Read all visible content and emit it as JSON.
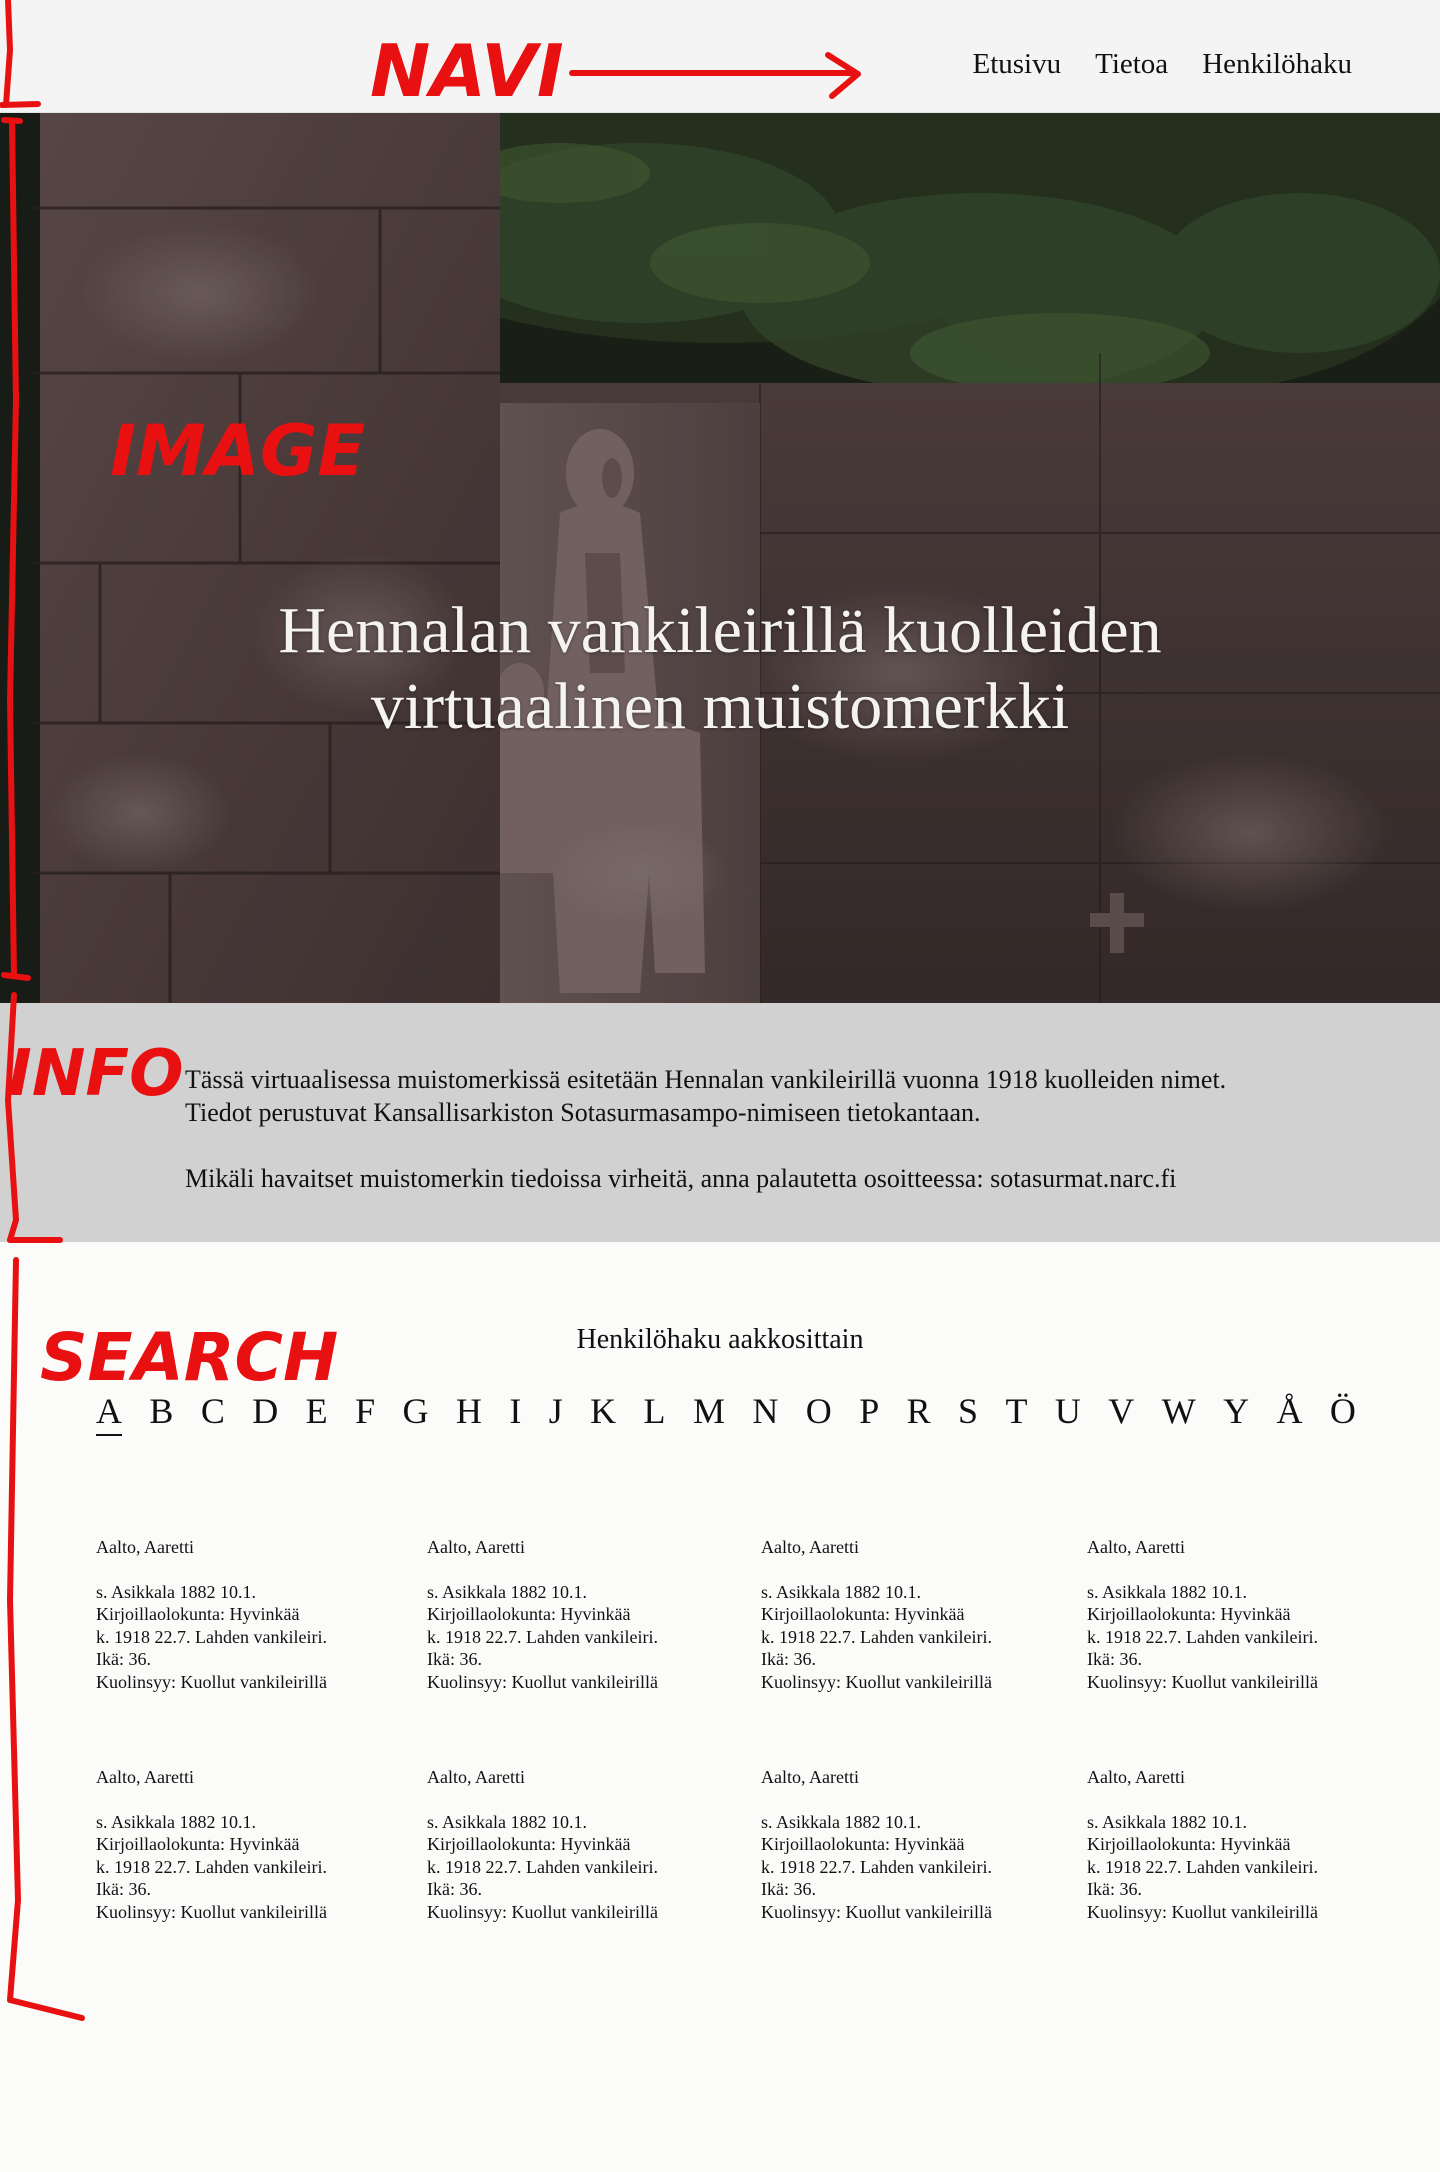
{
  "annotations": {
    "navi": "NAVI",
    "image": "IMAGE",
    "info": "INFO",
    "search": "SEARCH"
  },
  "nav": {
    "links": [
      "Etusivu",
      "Tietoa",
      "Henkilöhaku"
    ]
  },
  "hero": {
    "title_line1": "Hennalan vankileirillä kuolleiden",
    "title_line2": "virtuaalinen muistomerkki"
  },
  "info": {
    "paragraph1": "Tässä virtuaalisessa muistomerkissä esitetään Hennalan vankileirillä vuonna 1918 kuolleiden nimet. Tiedot perustuvat Kansallisarkiston Sotasurmasampo-nimiseen tietokantaan.",
    "paragraph2": "Mikäli havaitset muistomerkin tiedoissa virheitä, anna palautetta osoitteessa: sotasurmat.narc.fi"
  },
  "search": {
    "heading": "Henkilöhaku aakkosittain",
    "letters": [
      "A",
      "B",
      "C",
      "D",
      "E",
      "F",
      "G",
      "H",
      "I",
      "J",
      "K",
      "L",
      "M",
      "N",
      "O",
      "P",
      "R",
      "S",
      "T",
      "U",
      "V",
      "W",
      "Y",
      "Å",
      "Ö"
    ],
    "active_letter": "A"
  },
  "results": [
    {
      "name": "Aalto, Aaretti",
      "born": "s. Asikkala 1882 10.1.",
      "municipality": "Kirjoillaolokunta: Hyvinkää",
      "died": "k. 1918 22.7. Lahden vankileiri.",
      "age": "Ikä: 36.",
      "cause": "Kuolinsyy: Kuollut vankileirillä"
    },
    {
      "name": "Aalto, Aaretti",
      "born": "s. Asikkala 1882 10.1.",
      "municipality": "Kirjoillaolokunta: Hyvinkää",
      "died": "k. 1918 22.7. Lahden vankileiri.",
      "age": "Ikä: 36.",
      "cause": "Kuolinsyy: Kuollut vankileirillä"
    },
    {
      "name": "Aalto, Aaretti",
      "born": "s. Asikkala 1882 10.1.",
      "municipality": "Kirjoillaolokunta: Hyvinkää",
      "died": "k. 1918 22.7. Lahden vankileiri.",
      "age": "Ikä: 36.",
      "cause": "Kuolinsyy: Kuollut vankileirillä"
    },
    {
      "name": "Aalto, Aaretti",
      "born": "s. Asikkala 1882 10.1.",
      "municipality": "Kirjoillaolokunta: Hyvinkää",
      "died": "k. 1918 22.7. Lahden vankileiri.",
      "age": "Ikä: 36.",
      "cause": "Kuolinsyy: Kuollut vankileirillä"
    },
    {
      "name": "Aalto, Aaretti",
      "born": "s. Asikkala 1882 10.1.",
      "municipality": "Kirjoillaolokunta: Hyvinkää",
      "died": "k. 1918 22.7. Lahden vankileiri.",
      "age": "Ikä: 36.",
      "cause": "Kuolinsyy: Kuollut vankileirillä"
    },
    {
      "name": "Aalto, Aaretti",
      "born": "s. Asikkala 1882 10.1.",
      "municipality": "Kirjoillaolokunta: Hyvinkää",
      "died": "k. 1918 22.7. Lahden vankileiri.",
      "age": "Ikä: 36.",
      "cause": "Kuolinsyy: Kuollut vankileirillä"
    },
    {
      "name": "Aalto, Aaretti",
      "born": "s. Asikkala 1882 10.1.",
      "municipality": "Kirjoillaolokunta: Hyvinkää",
      "died": "k. 1918 22.7. Lahden vankileiri.",
      "age": "Ikä: 36.",
      "cause": "Kuolinsyy: Kuollut vankileirillä"
    },
    {
      "name": "Aalto, Aaretti",
      "born": "s. Asikkala 1882 10.1.",
      "municipality": "Kirjoillaolokunta: Hyvinkää",
      "died": "k. 1918 22.7. Lahden vankileiri.",
      "age": "Ikä: 36.",
      "cause": "Kuolinsyy: Kuollut vankileirillä"
    }
  ],
  "colors": {
    "annotation": "#e81010",
    "info_background": "#d1d1d1",
    "nav_background": "#f4f4f4"
  }
}
